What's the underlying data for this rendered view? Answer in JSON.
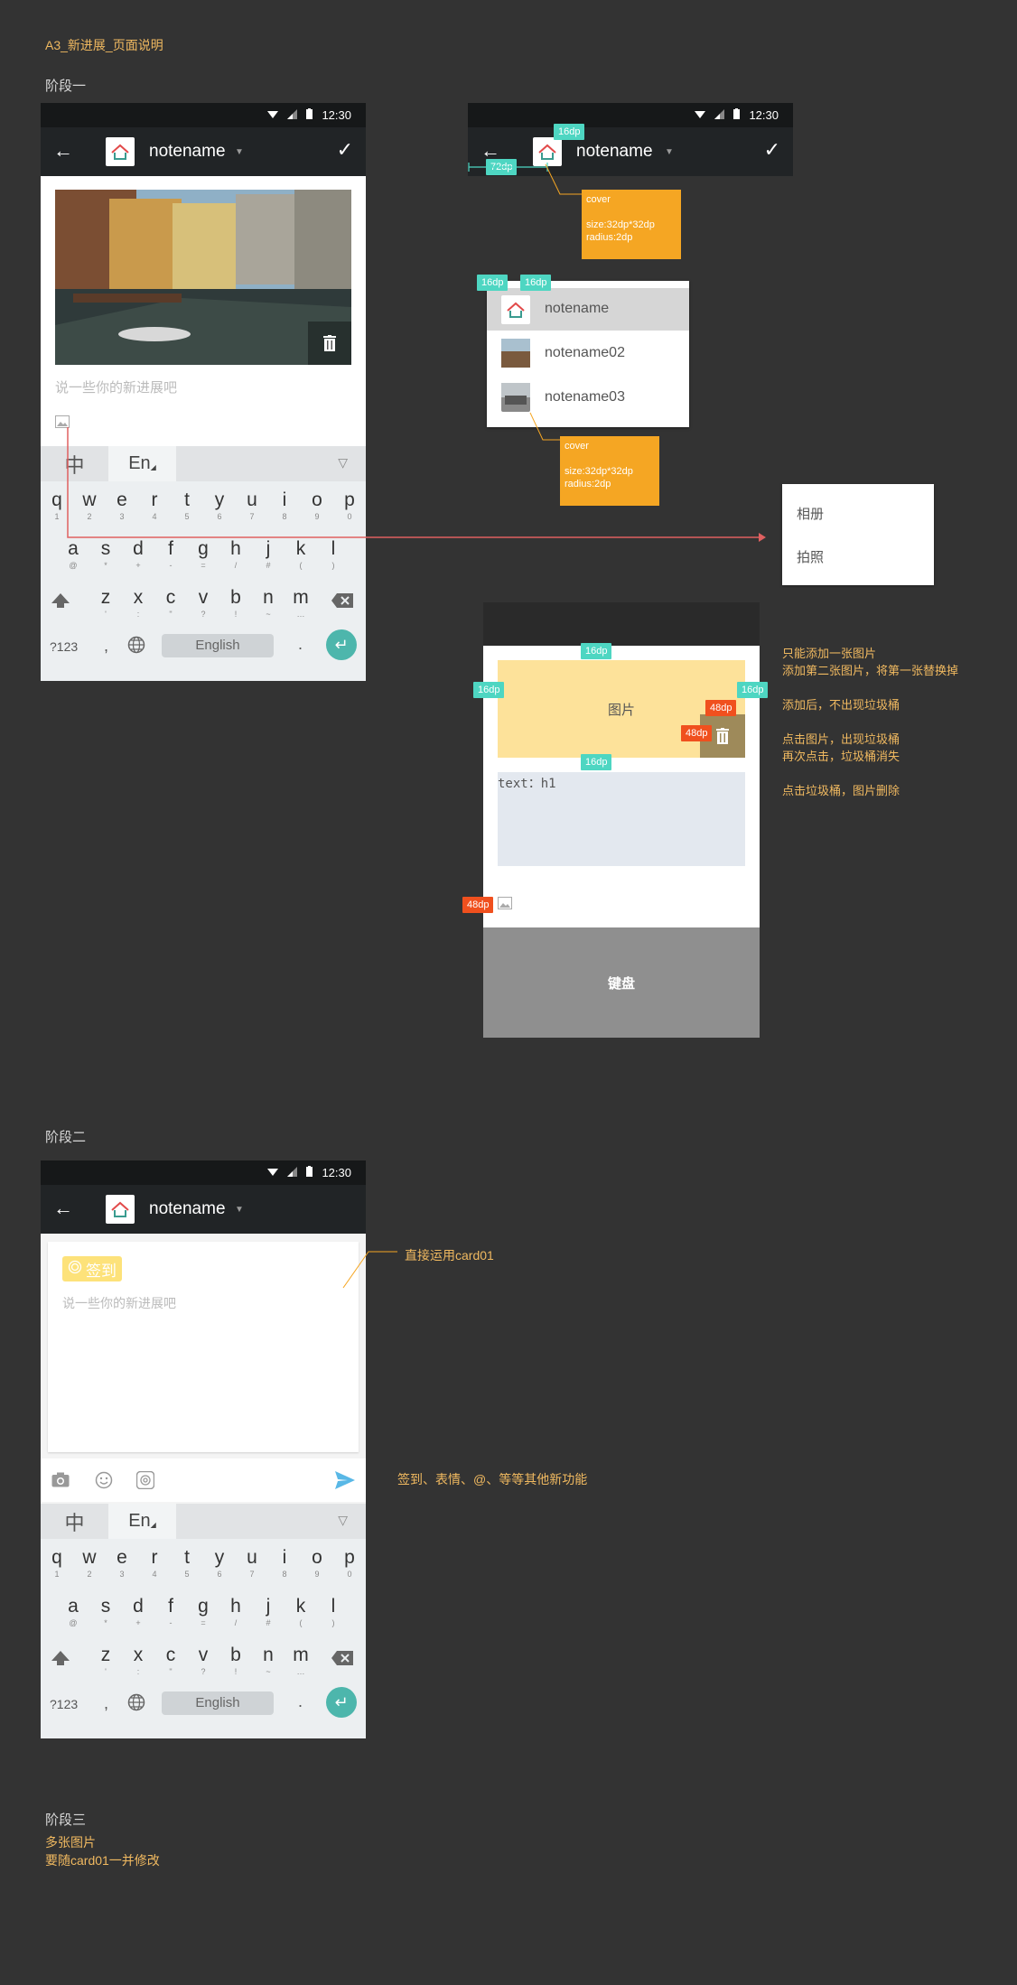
{
  "page_title": "A3_新进展_页面说明",
  "stage1": {
    "title": "阶段一",
    "status_time": "12:30",
    "note_name": "notename",
    "placeholder": "说一些你的新进展吧",
    "spec": {
      "tag_16": "16dp",
      "tag_72": "72dp",
      "tag_48": "48dp",
      "cover_note": [
        "cover",
        "",
        "size:32dp*32dp",
        "radius:2dp"
      ],
      "dropdown_items": [
        "notename",
        "notename02",
        "notename03"
      ],
      "menu_items": [
        "相册",
        "拍照"
      ],
      "image_label": "图片",
      "text_label": "text：h1",
      "keyboard_label": "键盘",
      "notes": [
        "只能添加一张图片",
        "添加第二张图片，将第一张替换掉",
        "",
        "添加后，不出现垃圾桶",
        "",
        "点击图片，出现垃圾桶",
        "再次点击，垃圾桶消失",
        "",
        "点击垃圾桶，图片删除"
      ]
    }
  },
  "stage2": {
    "title": "阶段二",
    "status_time": "12:30",
    "note_name": "notename",
    "checkin_label": "签到",
    "placeholder": "说一些你的新进展吧",
    "note_card": "直接运用card01",
    "note_toolbar": "签到、表情、@、等等其他新功能"
  },
  "stage3": {
    "title": "阶段三",
    "lines": [
      "多张图片",
      "要随card01一并修改"
    ]
  },
  "keyboard": {
    "zh": "中",
    "en": "En",
    "row1": [
      [
        "q",
        "1"
      ],
      [
        "w",
        "2"
      ],
      [
        "e",
        "3"
      ],
      [
        "r",
        "4"
      ],
      [
        "t",
        "5"
      ],
      [
        "y",
        "6"
      ],
      [
        "u",
        "7"
      ],
      [
        "i",
        "8"
      ],
      [
        "o",
        "9"
      ],
      [
        "p",
        "0"
      ]
    ],
    "row2": [
      [
        "a",
        "@"
      ],
      [
        "s",
        "*"
      ],
      [
        "d",
        "+"
      ],
      [
        "f",
        "-"
      ],
      [
        "g",
        "="
      ],
      [
        "h",
        "/"
      ],
      [
        "j",
        "#"
      ],
      [
        "k",
        "("
      ],
      [
        "l",
        ")"
      ]
    ],
    "row3": [
      [
        "z",
        "'"
      ],
      [
        "x",
        ":"
      ],
      [
        "c",
        "\""
      ],
      [
        "v",
        "?"
      ],
      [
        "b",
        "!"
      ],
      [
        "n",
        "~"
      ],
      [
        "m",
        "…"
      ]
    ],
    "sym": "?123",
    "comma": ",",
    "space": "English",
    "period": "."
  },
  "colors": {
    "background": "#333333",
    "accent_orange": "#f5a623",
    "tag_cyan": "#4ed6c2",
    "tag_red": "#f0501e",
    "enter_teal": "#4db6ac",
    "guide_line": "#e06060"
  }
}
